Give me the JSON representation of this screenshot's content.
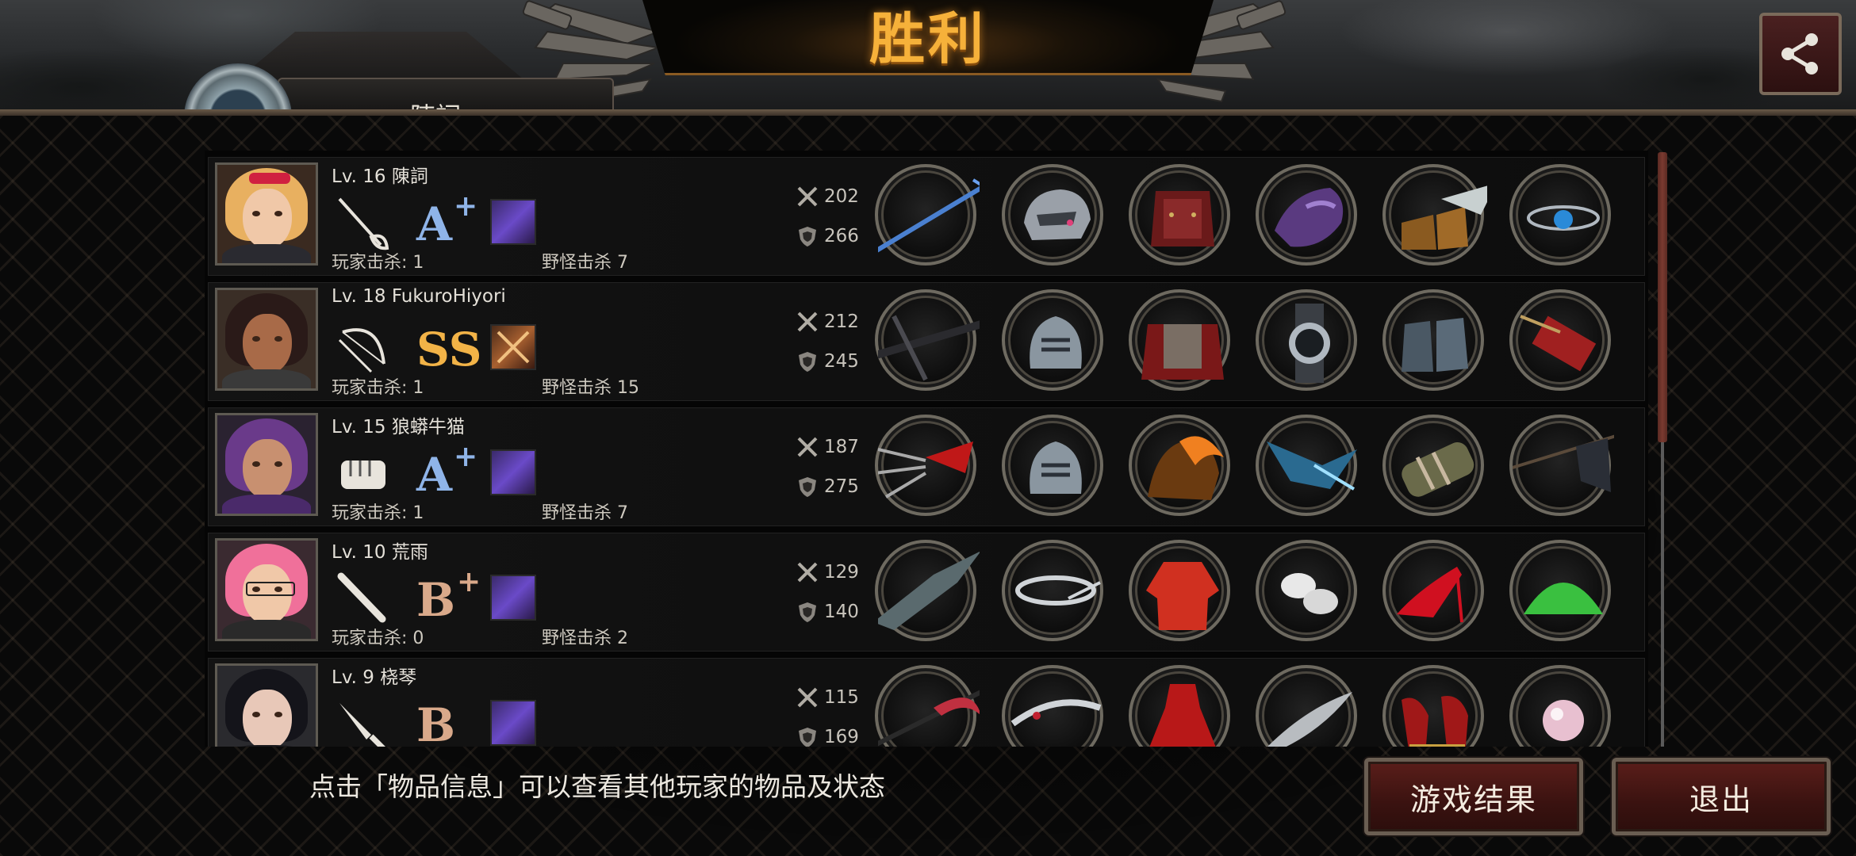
{
  "title": "胜利",
  "tab_peek_label": "陳詞",
  "hint_text": "点击「物品信息」可以查看其他玩家的物品及状态",
  "buttons": {
    "result": "游戏结果",
    "exit": "退出"
  },
  "players": [
    {
      "level_name": "Lv. 16 陳詞",
      "weapon": "rapier-icon",
      "grade": "A",
      "grade_sup": "+",
      "grade_color": "#8fb4e8",
      "skill": "purple-skill-icon",
      "player_kills": "玩家击杀: 1",
      "monster_kills": "野怪击杀 7",
      "attack": "202",
      "defense": "266",
      "items": [
        "blue-trident-icon",
        "silver-helmet-icon",
        "red-armor-icon",
        "purple-gauntlet-icon",
        "feathered-boots-icon",
        "blue-gem-amulet-icon"
      ]
    },
    {
      "level_name": "Lv. 18 FukuroHiyori",
      "weapon": "bow-icon",
      "grade": "SS",
      "grade_sup": "",
      "grade_color": "#f2b347",
      "skill": "crossed-swords-skill-icon",
      "player_kills": "玩家击杀: 1",
      "monster_kills": "野怪击杀 15",
      "attack": "212",
      "defense": "245",
      "items": [
        "crossbow-icon",
        "knight-helmet-icon",
        "red-cape-armor-icon",
        "watch-icon",
        "steel-boots-icon",
        "quiver-icon"
      ]
    },
    {
      "level_name": "Lv. 15 狼蟒牛猫",
      "weapon": "fist-icon",
      "grade": "A",
      "grade_sup": "+",
      "grade_color": "#8fb4e8",
      "skill": "purple-skill-icon",
      "player_kills": "玩家击杀: 1",
      "monster_kills": "野怪击杀 7",
      "attack": "187",
      "defense": "275",
      "items": [
        "red-claw-icon",
        "knight-helmet-icon",
        "flame-armor-icon",
        "blue-crystal-claw-icon",
        "bandage-arm-icon",
        "black-flag-icon"
      ]
    },
    {
      "level_name": "Lv. 10 荒雨",
      "weapon": "bat-icon",
      "grade": "B",
      "grade_sup": "+",
      "grade_color": "#d9a98a",
      "skill": "purple-skill-icon",
      "player_kills": "玩家击杀: 0",
      "monster_kills": "野怪击杀 2",
      "attack": "129",
      "defense": "140",
      "items": [
        "dark-blade-icon",
        "silver-circlet-icon",
        "red-jacket-icon",
        "white-wristband-icon",
        "red-heels-icon",
        "green-powder-icon"
      ]
    },
    {
      "level_name": "Lv. 9   桡琴",
      "weapon": "knife-icon",
      "grade": "B",
      "grade_sup": "",
      "grade_color": "#d9a98a",
      "skill": "purple-skill-icon",
      "player_kills": "",
      "monster_kills": "",
      "attack": "115",
      "defense": "169",
      "items": [
        "red-scythe-icon",
        "silver-tiara-icon",
        "red-dress-icon",
        "feather-icon",
        "red-gold-heels-icon",
        "pearl-icon"
      ]
    }
  ],
  "colors": {
    "title": "#f6b13a",
    "button_bg": "#3a1210",
    "accent_border": "#6a5e52"
  }
}
